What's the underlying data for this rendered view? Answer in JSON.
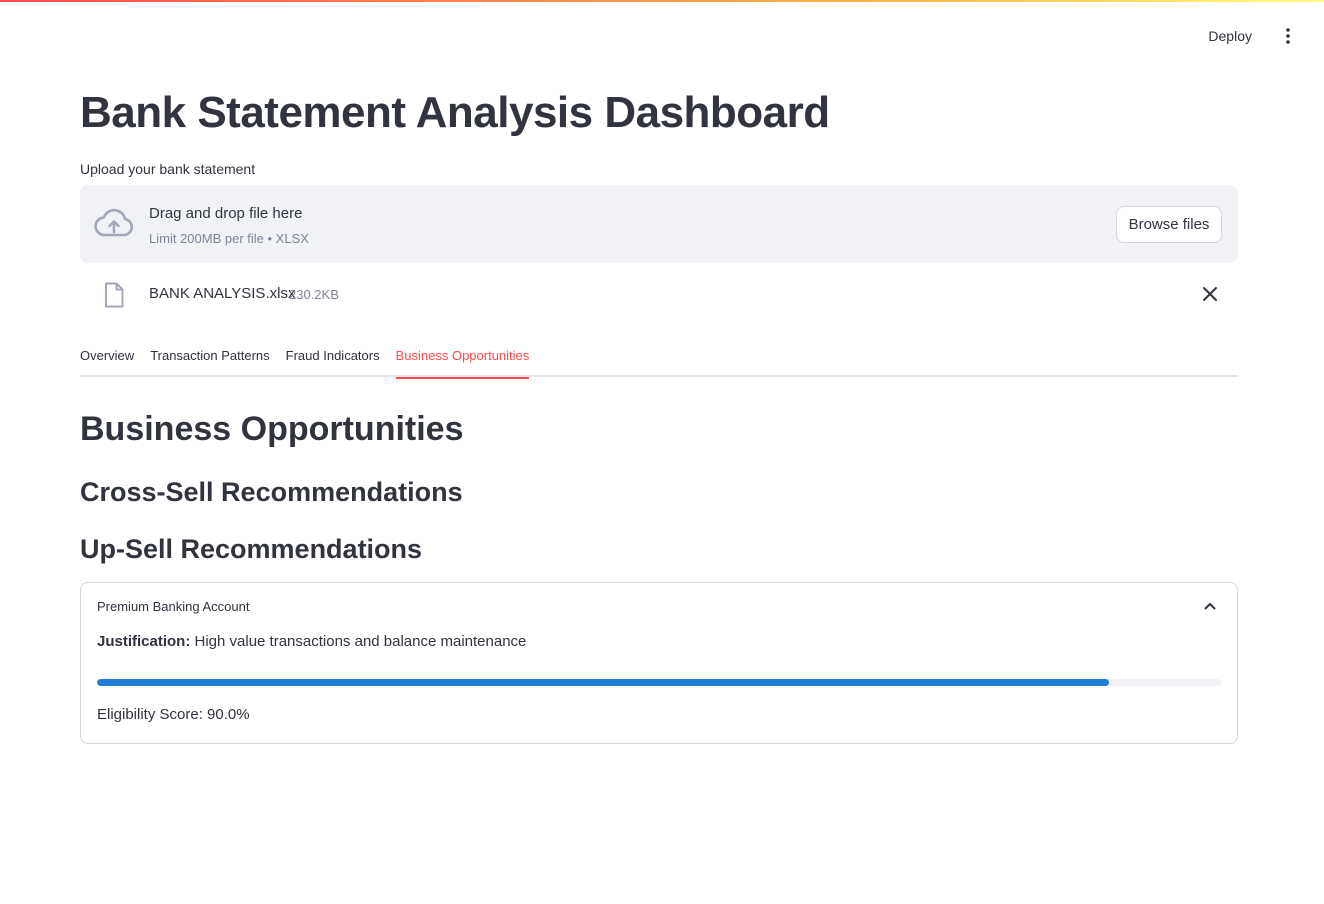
{
  "header": {
    "deploy_label": "Deploy",
    "menu_icon": "more-vertical-icon"
  },
  "page": {
    "title": "Bank Statement Analysis Dashboard"
  },
  "uploader": {
    "label": "Upload your bank statement",
    "drop_title": "Drag and drop file here",
    "drop_subtitle": "Limit 200MB per file • XLSX",
    "browse_label": "Browse files",
    "file": {
      "name": "BANK ANALYSIS.xlsx",
      "size": "230.2KB"
    }
  },
  "tabs": [
    {
      "label": "Overview",
      "active": false
    },
    {
      "label": "Transaction Patterns",
      "active": false
    },
    {
      "label": "Fraud Indicators",
      "active": false
    },
    {
      "label": "Business Opportunities",
      "active": true
    }
  ],
  "content": {
    "heading": "Business Opportunities",
    "cross_sell_heading": "Cross-Sell Recommendations",
    "up_sell_heading": "Up-Sell Recommendations",
    "expander": {
      "title": "Premium Banking Account",
      "justification_label": "Justification:",
      "justification_text": " High value transactions and balance maintenance",
      "progress_fraction": 0.9,
      "score_text": "Eligibility Score: 90.0%"
    }
  },
  "colors": {
    "accent": "#ff4b4b",
    "progress": "#1f7ed6",
    "text": "#31333f",
    "muted": "#808495",
    "dropzone_bg": "#f0f2f6"
  }
}
